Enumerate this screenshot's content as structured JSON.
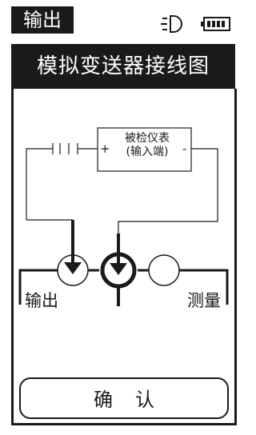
{
  "status_bar": {
    "mode": "输出",
    "icons": [
      "backlight-icon",
      "battery-icon"
    ]
  },
  "title": "模拟变送器接线图",
  "diagram": {
    "instrument_line1": "被检仪表",
    "instrument_line2": "(输入端)",
    "plus_sign": "+",
    "minus_sign": "-",
    "left_port_label": "输出",
    "right_port_label": "测量"
  },
  "confirm_label": "确认",
  "colors": {
    "ink": "#1a1a1a",
    "background": "#ffffff"
  }
}
